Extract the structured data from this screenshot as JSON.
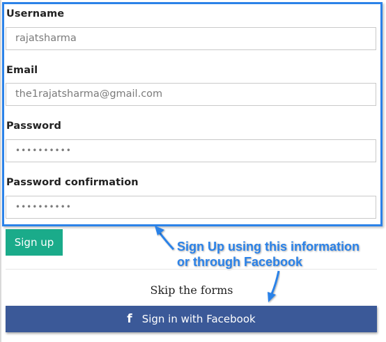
{
  "form": {
    "username": {
      "label": "Username",
      "value": "rajatsharma"
    },
    "email": {
      "label": "Email",
      "value": "the1rajatsharma@gmail.com"
    },
    "password": {
      "label": "Password",
      "value": "••••••••••"
    },
    "password_confirmation": {
      "label": "Password confirmation",
      "value": "••••••••••"
    }
  },
  "actions": {
    "signup_label": "Sign up",
    "skip_text": "Skip the forms",
    "facebook_label": "Sign in with Facebook",
    "facebook_icon": "f"
  },
  "annotation": {
    "line1": "Sign Up using this information",
    "line2": "or through Facebook"
  },
  "icons": {
    "facebook": "facebook-icon",
    "arrows": "callout-arrow-icon"
  },
  "colors": {
    "highlight": "#2b82e8",
    "signup_button": "#1aab8a",
    "facebook_button": "#3b5998"
  }
}
